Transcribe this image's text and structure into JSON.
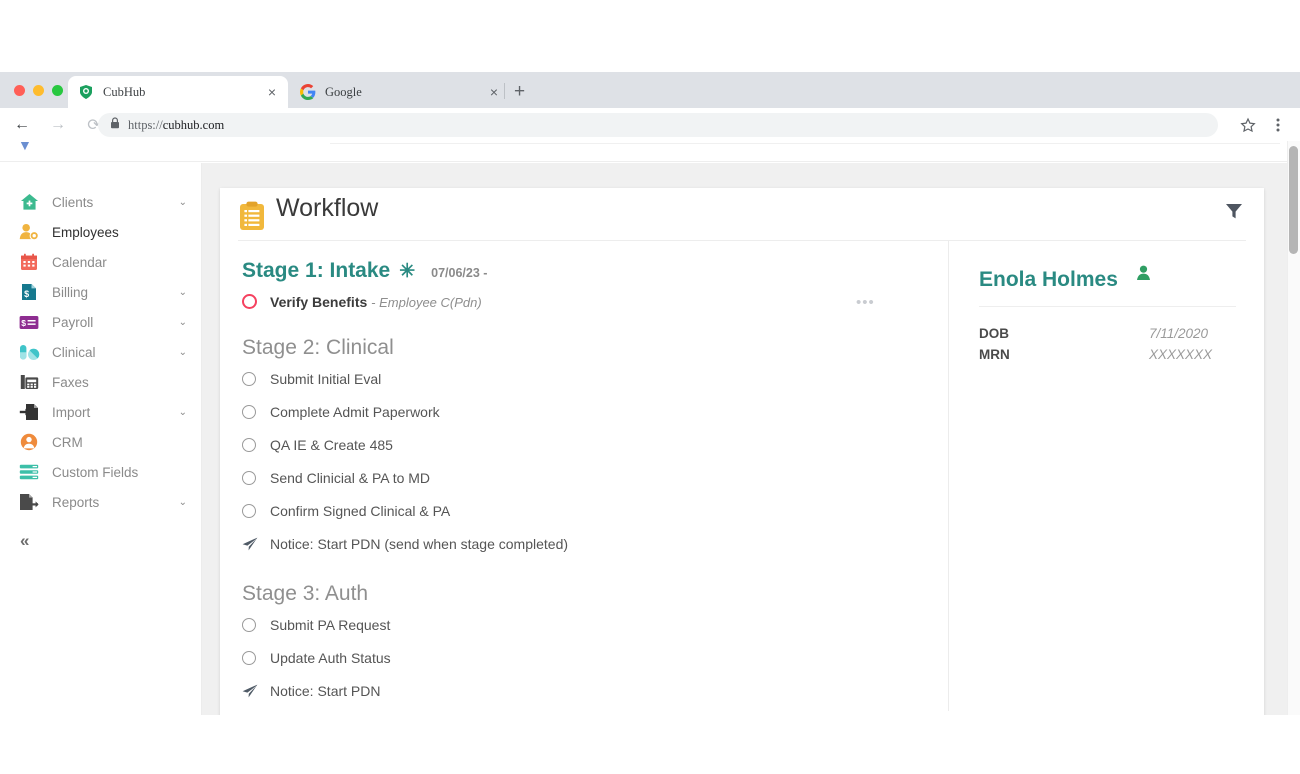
{
  "browser": {
    "tabs": [
      {
        "title": "CubHub",
        "favicon": "cubhub-shield-icon",
        "active": true,
        "close_label": "×"
      },
      {
        "title": "Google",
        "favicon": "google-g-icon",
        "active": false,
        "close_label": "×"
      }
    ],
    "new_tab_label": "+",
    "back_label": "←",
    "forward_label": "→",
    "reload_label": "⟳",
    "url_prefix": "https://",
    "url_domain": "cubhub.com",
    "bookmark_icon": "star-icon",
    "menu_icon": "kebab-menu-icon"
  },
  "sidebar": {
    "collapse_label": "«",
    "items": [
      {
        "label": "Clients",
        "icon": "home-plus-icon",
        "color": "#3cba8f",
        "caret": "⌄",
        "active": false
      },
      {
        "label": "Employees",
        "icon": "employee-clock-icon",
        "color": "#f0b440",
        "caret": "",
        "active": true
      },
      {
        "label": "Calendar",
        "icon": "calendar-icon",
        "color": "#f2695a",
        "caret": "",
        "active": false
      },
      {
        "label": "Billing",
        "icon": "invoice-dollar-icon",
        "color": "#16798e",
        "caret": "⌄",
        "active": false
      },
      {
        "label": "Payroll",
        "icon": "payroll-card-icon",
        "color": "#8e2d91",
        "caret": "⌄",
        "active": false
      },
      {
        "label": "Clinical",
        "icon": "pill-capsule-icon",
        "color": "#3fc4c9",
        "caret": "⌄",
        "active": false
      },
      {
        "label": "Faxes",
        "icon": "fax-machine-icon",
        "color": "#4a4a4a",
        "caret": "",
        "active": false
      },
      {
        "label": "Import",
        "icon": "file-import-icon",
        "color": "#333333",
        "caret": "⌄",
        "active": false
      },
      {
        "label": "CRM",
        "icon": "user-circle-icon",
        "color": "#ef8b3c",
        "caret": "",
        "active": false
      },
      {
        "label": "Custom Fields",
        "icon": "list-stack-icon",
        "color": "#3cbfa8",
        "caret": "",
        "active": false
      },
      {
        "label": "Reports",
        "icon": "report-export-icon",
        "color": "#4a4a4a",
        "caret": "⌄",
        "active": false
      }
    ]
  },
  "card": {
    "title": "Workflow",
    "title_icon": "clipboard-checklist-icon",
    "filter_icon": "filter-funnel-icon",
    "overflow_label": "•••"
  },
  "workflow": {
    "stages": [
      {
        "title": "Stage 1: Intake",
        "star": "✳",
        "date": "07/06/23 -",
        "current": true,
        "tasks": [
          {
            "label": "Verify Benefits",
            "sub": "- Employee C(Pdn)",
            "mark": "ring-red",
            "first": true,
            "has_menu": true
          }
        ]
      },
      {
        "title": "Stage 2: Clinical",
        "star": "",
        "date": "",
        "current": false,
        "tasks": [
          {
            "label": "Submit Initial Eval",
            "sub": "",
            "mark": "ring",
            "first": false,
            "has_menu": false
          },
          {
            "label": "Complete Admit Paperwork",
            "sub": "",
            "mark": "ring",
            "first": false,
            "has_menu": false
          },
          {
            "label": "QA IE & Create 485",
            "sub": "",
            "mark": "ring",
            "first": false,
            "has_menu": false
          },
          {
            "label": "Send Clinicial & PA to MD",
            "sub": "",
            "mark": "ring",
            "first": false,
            "has_menu": false
          },
          {
            "label": "Confirm Signed Clinical & PA",
            "sub": "",
            "mark": "ring",
            "first": false,
            "has_menu": false
          },
          {
            "label": "Notice: Start PDN (send when stage completed)",
            "sub": "",
            "mark": "plane",
            "first": false,
            "has_menu": false
          }
        ]
      },
      {
        "title": "Stage 3: Auth",
        "star": "",
        "date": "",
        "current": false,
        "tasks": [
          {
            "label": "Submit PA Request",
            "sub": "",
            "mark": "ring",
            "first": false,
            "has_menu": false
          },
          {
            "label": "Update Auth Status",
            "sub": "",
            "mark": "ring",
            "first": false,
            "has_menu": false
          },
          {
            "label": "Notice: Start PDN",
            "sub": "",
            "mark": "plane",
            "first": false,
            "has_menu": false
          }
        ]
      }
    ]
  },
  "patient": {
    "name": "Enola Holmes",
    "person_icon": "person-icon",
    "fields": [
      {
        "key": "DOB",
        "value": "7/11/2020"
      },
      {
        "key": "MRN",
        "value": "XXXXXXX"
      }
    ]
  },
  "colors": {
    "teal": "#2a8a82",
    "red": "#f5415f",
    "yellow": "#f0b440"
  }
}
